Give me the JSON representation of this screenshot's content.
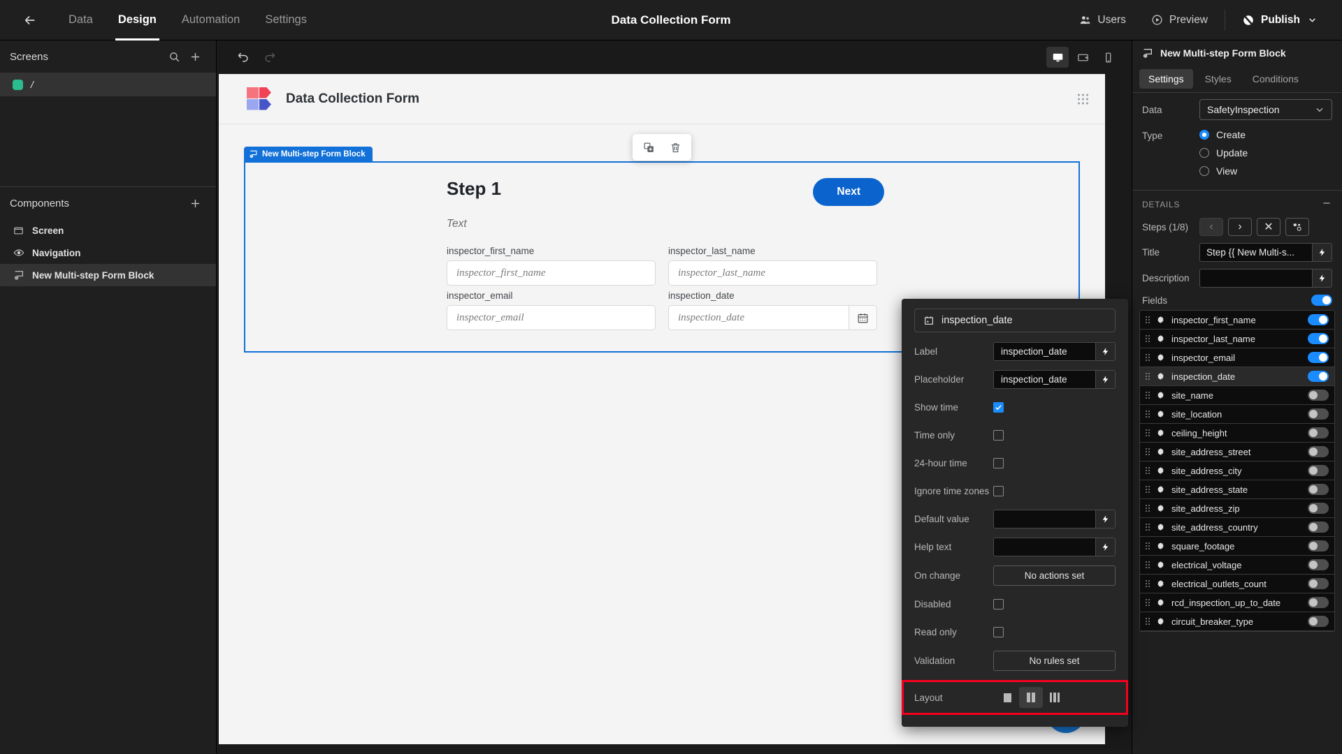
{
  "topbar": {
    "back_icon": "arrow-left-icon",
    "nav": [
      {
        "label": "Data",
        "active": false
      },
      {
        "label": "Design",
        "active": true
      },
      {
        "label": "Automation",
        "active": false
      },
      {
        "label": "Settings",
        "active": false
      }
    ],
    "title": "Data Collection Form",
    "users_label": "Users",
    "preview_label": "Preview",
    "publish_label": "Publish"
  },
  "left_sidebar": {
    "screens_title": "Screens",
    "screens": [
      {
        "label": "/"
      }
    ],
    "components_title": "Components",
    "components": [
      {
        "label": "Screen",
        "icon": "screen-icon",
        "selected": false
      },
      {
        "label": "Navigation",
        "icon": "eye-icon",
        "selected": false
      },
      {
        "label": "New Multi-step Form Block",
        "icon": "form-block-icon",
        "selected": true
      }
    ]
  },
  "canvas": {
    "undo_icon": "undo-icon",
    "redo_icon": "redo-icon",
    "devices": [
      {
        "name": "desktop-icon",
        "selected": true
      },
      {
        "name": "tablet-icon",
        "selected": false
      },
      {
        "name": "mobile-icon",
        "selected": false
      }
    ],
    "form_title": "Data Collection Form",
    "float_tools": [
      {
        "name": "duplicate-icon"
      },
      {
        "name": "delete-icon"
      }
    ],
    "block_tag": "New Multi-step Form Block",
    "step_title": "Step 1",
    "step_text": "Text",
    "next_label": "Next",
    "fields": [
      {
        "label": "inspector_first_name",
        "placeholder": "inspector_first_name",
        "type": "text"
      },
      {
        "label": "inspector_last_name",
        "placeholder": "inspector_last_name",
        "type": "text"
      },
      {
        "label": "inspector_email",
        "placeholder": "inspector_email",
        "type": "text"
      },
      {
        "label": "inspection_date",
        "placeholder": "inspection_date",
        "type": "date"
      }
    ]
  },
  "popover": {
    "header": "inspection_date",
    "header_icon": "calendar-icon",
    "label_row": "Label",
    "label_value": "inspection_date",
    "placeholder_row": "Placeholder",
    "placeholder_value": "inspection_date",
    "show_time_row": "Show time",
    "show_time_checked": true,
    "time_only_row": "Time only",
    "time_only_checked": false,
    "hour24_row": "24-hour time",
    "hour24_checked": false,
    "ignore_tz_row": "Ignore time zones",
    "ignore_tz_checked": false,
    "default_value_row": "Default value",
    "default_value": "",
    "help_text_row": "Help text",
    "help_text_value": "",
    "on_change_row": "On change",
    "on_change_value": "No actions set",
    "disabled_row": "Disabled",
    "disabled_checked": false,
    "read_only_row": "Read only",
    "read_only_checked": false,
    "validation_row": "Validation",
    "validation_value": "No rules set",
    "layout_row": "Layout",
    "layout_options": [
      {
        "name": "layout-one-column-icon",
        "bars": 1,
        "selected": false
      },
      {
        "name": "layout-two-columns-icon",
        "bars": 2,
        "selected": true
      },
      {
        "name": "layout-three-columns-icon",
        "bars": 3,
        "selected": false
      }
    ],
    "highlight_color": "#f5001e"
  },
  "right_sidebar": {
    "title": "New Multi-step Form Block",
    "title_icon": "form-block-icon",
    "tabs": [
      {
        "label": "Settings",
        "active": true
      },
      {
        "label": "Styles",
        "active": false
      },
      {
        "label": "Conditions",
        "active": false
      }
    ],
    "data_row": "Data",
    "data_value": "SafetyInspection",
    "type_row": "Type",
    "type_options": [
      {
        "label": "Create",
        "selected": true
      },
      {
        "label": "Update",
        "selected": false
      },
      {
        "label": "View",
        "selected": false
      }
    ],
    "details_title": "DETAILS",
    "steps_row": "Steps (1/8)",
    "step_buttons": [
      {
        "name": "prev-step-button",
        "glyph": "‹",
        "disabled": true
      },
      {
        "name": "next-step-button",
        "glyph": "›",
        "disabled": false
      },
      {
        "name": "delete-step-button",
        "glyph": "✕",
        "disabled": false
      },
      {
        "name": "reorder-steps-button",
        "glyph": "",
        "disabled": false
      }
    ],
    "title_label": "Title",
    "title_value": "Step {{ New Multi-s...",
    "description_label": "Description",
    "description_value": "",
    "fields_label": "Fields",
    "fields_enabled": true,
    "fields": [
      {
        "name": "inspector_first_name",
        "enabled": true,
        "selected": false
      },
      {
        "name": "inspector_last_name",
        "enabled": true,
        "selected": false
      },
      {
        "name": "inspector_email",
        "enabled": true,
        "selected": false
      },
      {
        "name": "inspection_date",
        "enabled": true,
        "selected": true
      },
      {
        "name": "site_name",
        "enabled": false,
        "selected": false
      },
      {
        "name": "site_location",
        "enabled": false,
        "selected": false
      },
      {
        "name": "ceiling_height",
        "enabled": false,
        "selected": false
      },
      {
        "name": "site_address_street",
        "enabled": false,
        "selected": false
      },
      {
        "name": "site_address_city",
        "enabled": false,
        "selected": false
      },
      {
        "name": "site_address_state",
        "enabled": false,
        "selected": false
      },
      {
        "name": "site_address_zip",
        "enabled": false,
        "selected": false
      },
      {
        "name": "site_address_country",
        "enabled": false,
        "selected": false
      },
      {
        "name": "square_footage",
        "enabled": false,
        "selected": false
      },
      {
        "name": "electrical_voltage",
        "enabled": false,
        "selected": false
      },
      {
        "name": "electrical_outlets_count",
        "enabled": false,
        "selected": false
      },
      {
        "name": "rcd_inspection_up_to_date",
        "enabled": false,
        "selected": false
      },
      {
        "name": "circuit_breaker_type",
        "enabled": false,
        "selected": false
      }
    ]
  },
  "colors": {
    "accent_blue": "#1a8cff",
    "canvas_blue": "#1271d8",
    "next_blue": "#0b63ce",
    "screen_dot_green": "#2bbd8e",
    "highlight_red": "#f5001e"
  }
}
